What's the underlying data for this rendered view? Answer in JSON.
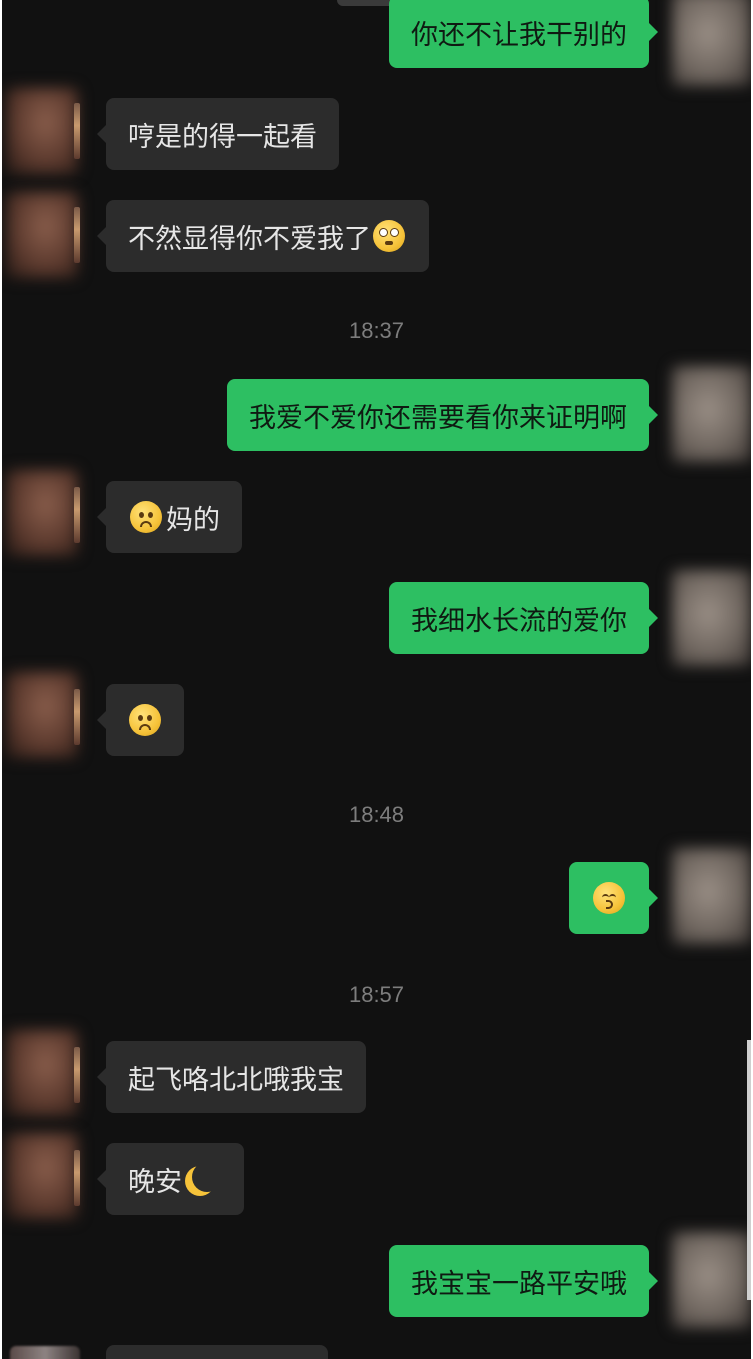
{
  "chat": {
    "messages": [
      {
        "side": "out",
        "text": "你还不让我干别的"
      },
      {
        "side": "in",
        "text": "哼是的得一起看"
      },
      {
        "side": "in",
        "text": "不然显得你不爱我了",
        "emoji": "face-with-rolling-eyes-emoji"
      },
      {
        "time": "18:37"
      },
      {
        "side": "out",
        "text": "我爱不爱你还需要看你来证明啊"
      },
      {
        "side": "in",
        "text": "妈的",
        "emoji": "frowning-face-emoji"
      },
      {
        "side": "out",
        "text": "我细水长流的爱你"
      },
      {
        "side": "in",
        "emoji": "frowning-face-emoji"
      },
      {
        "time": "18:48"
      },
      {
        "side": "out",
        "emoji": "kissing-face-emoji"
      },
      {
        "time": "18:57"
      },
      {
        "side": "in",
        "text": "起飞咯北北哦我宝"
      },
      {
        "side": "in",
        "text": "晚安",
        "emoji": "crescent-moon-emoji"
      },
      {
        "side": "out",
        "text": "我宝宝一路平安哦"
      }
    ]
  },
  "colors": {
    "background": "#111111",
    "incoming_bubble": "#2c2c2c",
    "outgoing_bubble": "#2dbf62",
    "timestamp_text": "#7d7d7d"
  }
}
